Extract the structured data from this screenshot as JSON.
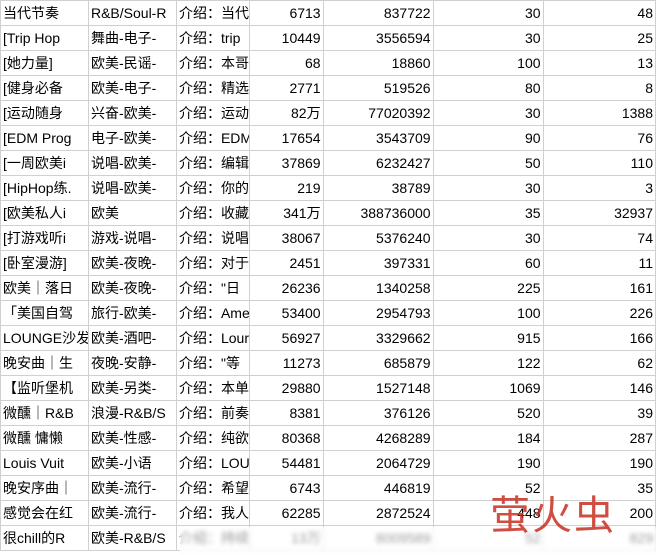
{
  "watermark": "萤火虫",
  "rows": [
    {
      "a": "当代节奏",
      "b": "R&B/Soul-R",
      "c": "介绍：当代",
      "d": "6713",
      "e": "837722",
      "f": "30",
      "g": "48"
    },
    {
      "a": "[Trip Hop",
      "b": "舞曲-电子-",
      "c": "介绍：trip",
      "d": "10449",
      "e": "3556594",
      "f": "30",
      "g": "25"
    },
    {
      "a": "[她力量]",
      "b": "欧美-民谣-",
      "c": "介绍：本哥",
      "d": "68",
      "e": "18860",
      "f": "100",
      "g": "13"
    },
    {
      "a": "[健身必备",
      "b": "欧美-电子-",
      "c": "介绍：精选",
      "d": "2771",
      "e": "519526",
      "f": "80",
      "g": "8"
    },
    {
      "a": "[运动随身",
      "b": "兴奋-欧美-",
      "c": "介绍：运动",
      "d": "82万",
      "e": "77020392",
      "f": "30",
      "g": "1388"
    },
    {
      "a": "[EDM Prog",
      "b": "电子-欧美-",
      "c": "介绍：EDM",
      "d": "17654",
      "e": "3543709",
      "f": "90",
      "g": "76"
    },
    {
      "a": "[一周欧美i",
      "b": "说唱-欧美-",
      "c": "介绍：编辑",
      "d": "37869",
      "e": "6232427",
      "f": "50",
      "g": "110"
    },
    {
      "a": "[HipHop练.",
      "b": "说唱-欧美-",
      "c": "介绍：你的",
      "d": "219",
      "e": "38789",
      "f": "30",
      "g": "3"
    },
    {
      "a": "[欧美私人i",
      "b": "欧美",
      "c": "介绍：收藏",
      "d": "341万",
      "e": "388736000",
      "f": "35",
      "g": "32937"
    },
    {
      "a": "[打游戏听i",
      "b": "游戏-说唱-",
      "c": "介绍：说唱",
      "d": "38067",
      "e": "5376240",
      "f": "30",
      "g": "74"
    },
    {
      "a": "[卧室漫游]",
      "b": "欧美-夜晚-",
      "c": "介绍：对于",
      "d": "2451",
      "e": "397331",
      "f": "60",
      "g": "11"
    },
    {
      "a": "欧美｜落日",
      "b": "欧美-夜晚-",
      "c": "介绍：\"日",
      "d": "26236",
      "e": "1340258",
      "f": "225",
      "g": "161"
    },
    {
      "a": "「美国自驾",
      "b": "旅行-欧美-",
      "c": "介绍：Amer",
      "d": "53400",
      "e": "2954793",
      "f": "100",
      "g": "226"
    },
    {
      "a": "LOUNGE沙发",
      "b": "欧美-酒吧-",
      "c": "介绍：Lour",
      "d": "56927",
      "e": "3329662",
      "f": "915",
      "g": "166"
    },
    {
      "a": "晚安曲｜生",
      "b": "夜晚-安静-",
      "c": "介绍：\"等",
      "d": "11273",
      "e": "685879",
      "f": "122",
      "g": "62"
    },
    {
      "a": "【监听堡机",
      "b": "欧美-另类-",
      "c": "介绍：本单",
      "d": "29880",
      "e": "1527148",
      "f": "1069",
      "g": "146"
    },
    {
      "a": "微醺｜R&B",
      "b": "浪漫-R&B/S",
      "c": "介绍：前奏",
      "d": "8381",
      "e": "376126",
      "f": "520",
      "g": "39"
    },
    {
      "a": "微醺 慵懒",
      "b": "欧美-性感-",
      "c": "介绍：纯欲",
      "d": "80368",
      "e": "4268289",
      "f": "184",
      "g": "287"
    },
    {
      "a": "Louis Vuit",
      "b": "欧美-小语",
      "c": "介绍：LOUI",
      "d": "54481",
      "e": "2064729",
      "f": "190",
      "g": "190"
    },
    {
      "a": "晚安序曲｜",
      "b": "欧美-流行-",
      "c": "介绍：希望",
      "d": "6743",
      "e": "446819",
      "f": "52",
      "g": "35"
    },
    {
      "a": "感觉会在红",
      "b": "欧美-流行-",
      "c": "介绍：我人",
      "d": "62285",
      "e": "2872524",
      "f": "448",
      "g": "200"
    },
    {
      "a": "很chill的R",
      "b": "欧美-R&B/S",
      "c": "介绍：持续",
      "d": "13万",
      "e": "8009589",
      "f": "52",
      "g": "829"
    }
  ]
}
